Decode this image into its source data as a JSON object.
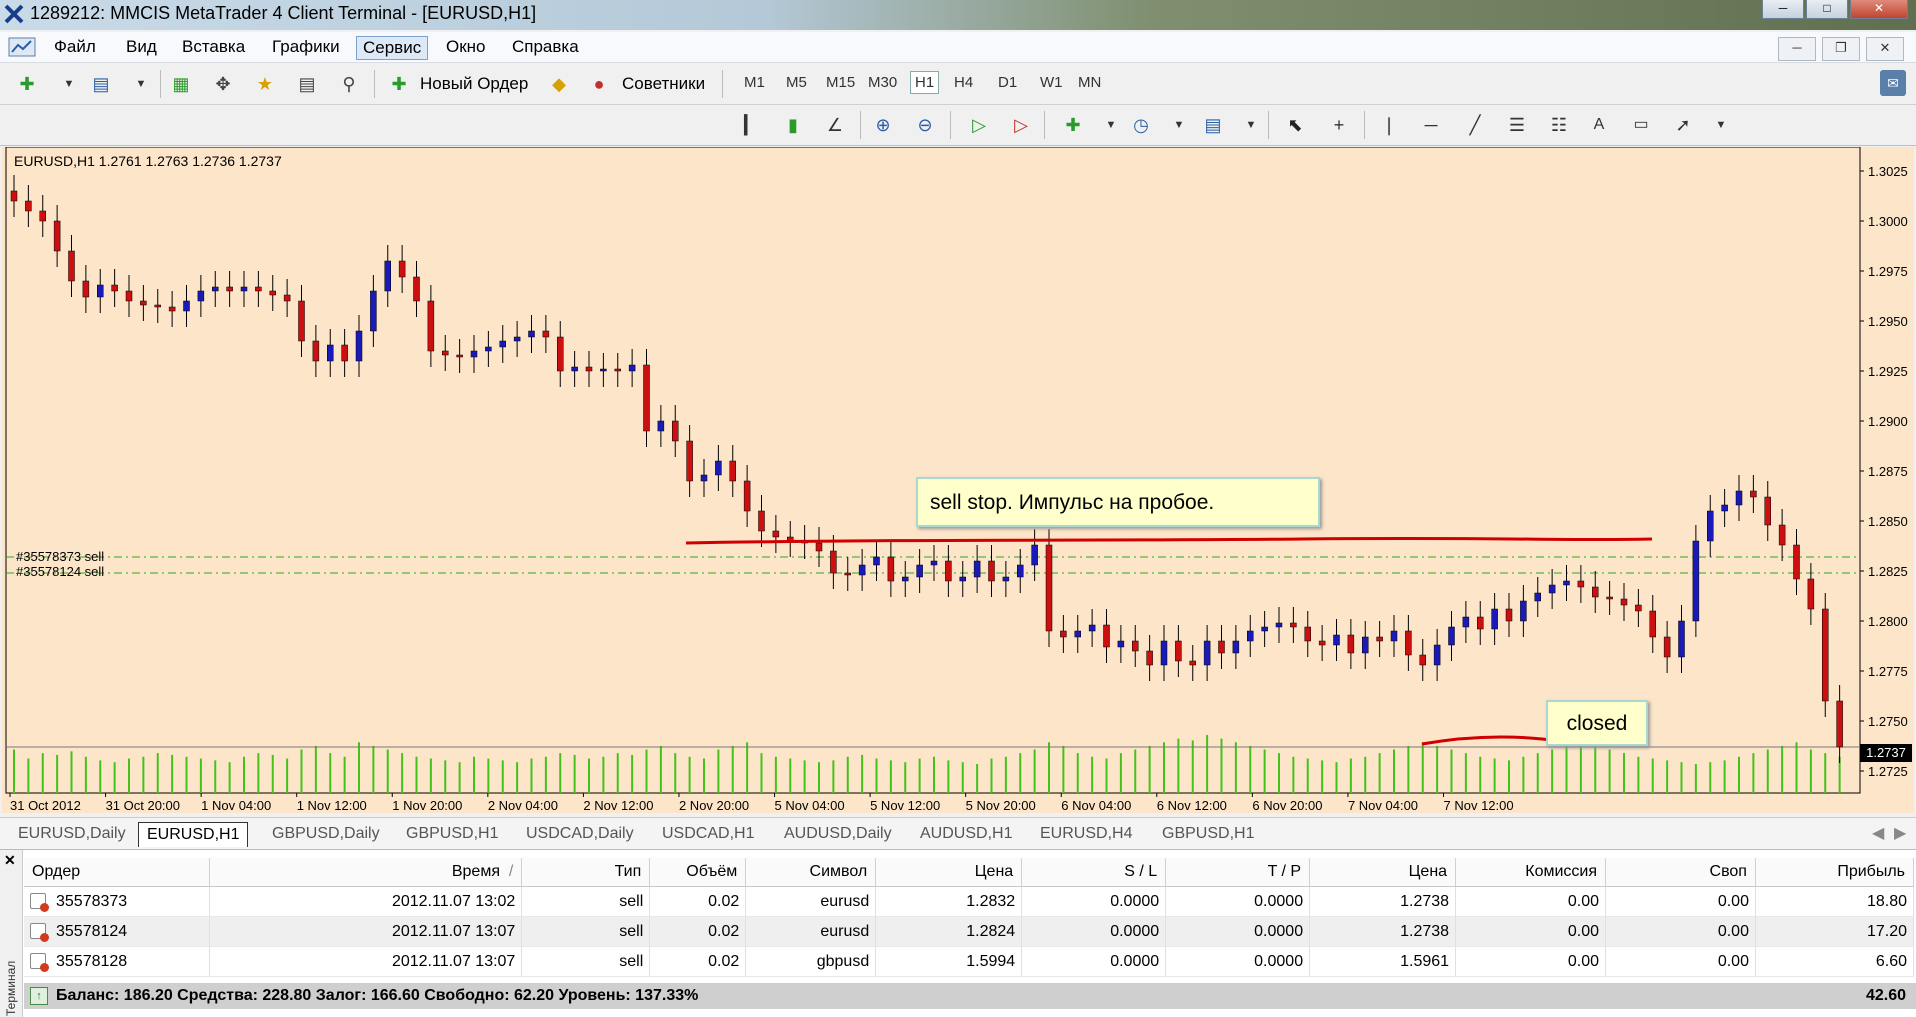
{
  "window": {
    "title": "1289212: MMCIS MetaTrader 4 Client Terminal - [EURUSD,H1]"
  },
  "menu": [
    {
      "label": "Файл"
    },
    {
      "label": "Вид"
    },
    {
      "label": "Вставка"
    },
    {
      "label": "Графики"
    },
    {
      "label": "Сервис"
    },
    {
      "label": "Окно"
    },
    {
      "label": "Справка"
    }
  ],
  "toolbar": {
    "new_order": "Новый Ордер",
    "experts": "Советники",
    "timeframes": [
      "M1",
      "M5",
      "M15",
      "M30",
      "H1",
      "H4",
      "D1",
      "W1",
      "MN"
    ],
    "active_timeframe": "H1"
  },
  "chart": {
    "header": "EURUSD,H1  1.2761 1.2763 1.2736 1.2737",
    "order_labels": [
      "#35578373 sell",
      "#35578124 sell"
    ],
    "current_price": "1.2737",
    "annotation_main": "sell stop. Импульс на пробое.",
    "annotation_closed": "closed",
    "colors": {
      "background": "#fde5c9",
      "bull": "#1a1ab8",
      "bear": "#cc1010",
      "volume": "#44c21a",
      "trendline": "#d00000",
      "order_line": "#22aa22"
    }
  },
  "chart_data": {
    "type": "candlestick",
    "symbol": "EURUSD",
    "timeframe": "H1",
    "x_tick_labels": [
      "31 Oct 2012",
      "31 Oct 20:00",
      "1 Nov 04:00",
      "1 Nov 12:00",
      "1 Nov 20:00",
      "2 Nov 04:00",
      "2 Nov 12:00",
      "2 Nov 20:00",
      "5 Nov 04:00",
      "5 Nov 12:00",
      "5 Nov 20:00",
      "6 Nov 04:00",
      "6 Nov 12:00",
      "6 Nov 20:00",
      "7 Nov 04:00",
      "7 Nov 12:00"
    ],
    "y_tick_labels": [
      "1.3025",
      "1.3000",
      "1.2975",
      "1.2950",
      "1.2925",
      "1.2900",
      "1.2875",
      "1.2850",
      "1.2825",
      "1.2800",
      "1.2775",
      "1.2750",
      "1.2725"
    ],
    "ylim": [
      1.2714,
      1.3037
    ],
    "horizontal_levels": [
      1.2832,
      1.2824
    ],
    "close": [
      1.301,
      1.3005,
      1.3,
      1.2985,
      1.297,
      1.2962,
      1.2968,
      1.2965,
      1.296,
      1.2958,
      1.2957,
      1.2955,
      1.296,
      1.2965,
      1.2967,
      1.2965,
      1.2967,
      1.2965,
      1.2963,
      1.296,
      1.294,
      1.293,
      1.2938,
      1.293,
      1.2945,
      1.2965,
      1.298,
      1.2972,
      1.296,
      1.2935,
      1.2933,
      1.2932,
      1.2935,
      1.2937,
      1.294,
      1.2942,
      1.2945,
      1.2942,
      1.2925,
      1.2927,
      1.2925,
      1.2926,
      1.2925,
      1.2928,
      1.2895,
      1.29,
      1.289,
      1.287,
      1.2873,
      1.288,
      1.287,
      1.2855,
      1.2845,
      1.2842,
      1.284,
      1.2839,
      1.2835,
      1.2824,
      1.2823,
      1.2828,
      1.2832,
      1.282,
      1.2822,
      1.2828,
      1.283,
      1.282,
      1.2822,
      1.283,
      1.282,
      1.2822,
      1.2828,
      1.2838,
      1.2795,
      1.2792,
      1.2795,
      1.2798,
      1.2787,
      1.279,
      1.2785,
      1.2778,
      1.279,
      1.278,
      1.2778,
      1.279,
      1.2784,
      1.279,
      1.2795,
      1.2797,
      1.2799,
      1.2797,
      1.279,
      1.2788,
      1.2793,
      1.2784,
      1.2792,
      1.279,
      1.2795,
      1.2783,
      1.2778,
      1.2788,
      1.2797,
      1.2802,
      1.2796,
      1.2806,
      1.28,
      1.281,
      1.2814,
      1.2818,
      1.282,
      1.2817,
      1.2812,
      1.2811,
      1.2808,
      1.2805,
      1.2792,
      1.2782,
      1.28,
      1.284,
      1.2855,
      1.2858,
      1.2865,
      1.2862,
      1.2848,
      1.2838,
      1.2821,
      1.2806,
      1.276,
      1.2737
    ],
    "volume": [
      120,
      95,
      110,
      105,
      115,
      100,
      90,
      85,
      95,
      100,
      110,
      105,
      100,
      95,
      90,
      85,
      100,
      110,
      105,
      95,
      120,
      130,
      110,
      100,
      140,
      130,
      120,
      110,
      100,
      95,
      90,
      85,
      100,
      95,
      90,
      85,
      95,
      100,
      110,
      105,
      95,
      100,
      110,
      105,
      120,
      130,
      110,
      100,
      95,
      120,
      130,
      140,
      110,
      100,
      95,
      90,
      85,
      90,
      100,
      105,
      95,
      90,
      85,
      95,
      100,
      90,
      85,
      80,
      95,
      100,
      110,
      120,
      140,
      130,
      110,
      100,
      95,
      110,
      120,
      130,
      140,
      150,
      145,
      160,
      150,
      140,
      130,
      120,
      110,
      100,
      95,
      90,
      85,
      95,
      100,
      110,
      120,
      130,
      140,
      130,
      120,
      110,
      100,
      95,
      90,
      100,
      110,
      120,
      130,
      140,
      130,
      120,
      110,
      100,
      95,
      90,
      85,
      80,
      85,
      90,
      100,
      110,
      120,
      130,
      140,
      120,
      110,
      100
    ]
  },
  "symbol_tabs": [
    "EURUSD,Daily",
    "EURUSD,H1",
    "GBPUSD,Daily",
    "GBPUSD,H1",
    "USDCAD,Daily",
    "USDCAD,H1",
    "AUDUSD,Daily",
    "AUDUSD,H1",
    "EURUSD,H4",
    "GBPUSD,H1"
  ],
  "active_tab": "EURUSD,H1",
  "terminal": {
    "side_label": "Терминал",
    "headers": [
      "Ордер",
      "Время",
      "Тип",
      "Объём",
      "Символ",
      "Цена",
      "S / L",
      "T / P",
      "Цена",
      "Комиссия",
      "Своп",
      "Прибыль"
    ],
    "sort_marker": "/",
    "rows": [
      [
        "35578373",
        "2012.11.07 13:02",
        "sell",
        "0.02",
        "eurusd",
        "1.2832",
        "0.0000",
        "0.0000",
        "1.2738",
        "0.00",
        "0.00",
        "18.80"
      ],
      [
        "35578124",
        "2012.11.07 13:07",
        "sell",
        "0.02",
        "eurusd",
        "1.2824",
        "0.0000",
        "0.0000",
        "1.2738",
        "0.00",
        "0.00",
        "17.20"
      ],
      [
        "35578128",
        "2012.11.07 13:07",
        "sell",
        "0.02",
        "gbpusd",
        "1.5994",
        "0.0000",
        "0.0000",
        "1.5961",
        "0.00",
        "0.00",
        "6.60"
      ]
    ],
    "balance_line": "Баланс: 186.20  Средства: 228.80  Залог: 166.60  Свободно: 62.20  Уровень: 137.33%",
    "total_profit": "42.60"
  }
}
